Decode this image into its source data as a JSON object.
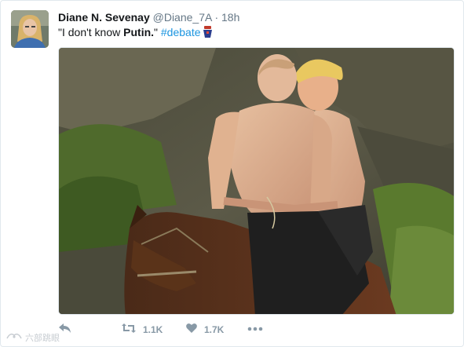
{
  "tweet": {
    "display_name": "Diane N. Sevenay",
    "handle": "@Diane_7A",
    "separator": "·",
    "timestamp": "18h",
    "text_prefix": "\"I don't know ",
    "text_bold": "Putin.",
    "text_suffix": "\" ",
    "hashtag": "#debate",
    "hashtag_icon": "podium-icon"
  },
  "actions": {
    "reply_icon": "reply-icon",
    "retweet_icon": "retweet-icon",
    "retweet_count": "1.1K",
    "like_icon": "heart-icon",
    "like_count": "1.7K",
    "more_icon": "more-icon"
  },
  "watermark": {
    "text": "六部跳眼"
  },
  "colors": {
    "link": "#1b95e0",
    "muted": "#657786",
    "action": "#8899a6",
    "border": "#e1e8ed"
  }
}
